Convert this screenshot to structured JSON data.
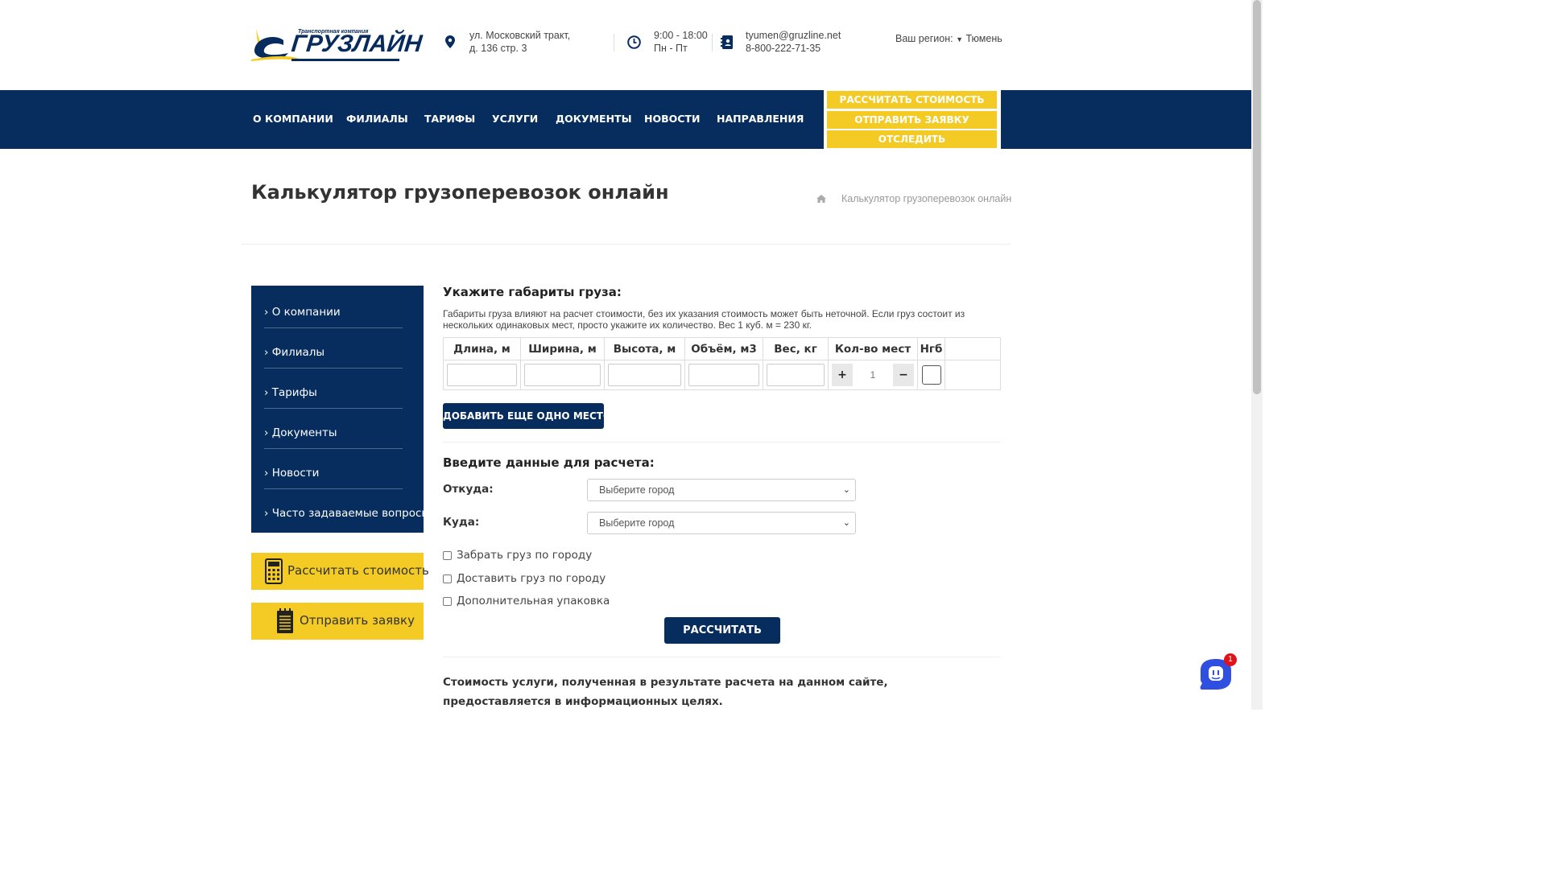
{
  "header": {
    "logo_text": "ГРУЗЛАЙН",
    "logo_subtext": "Транспортная компания",
    "address_line1": "ул. Московский тракт,",
    "address_line2": "д. 136 стр. 3",
    "hours_line1": "9:00 - 18:00",
    "hours_line2": "Пн - Пт",
    "email": "tyumen@gruzline.net",
    "phone": "8-800-222-71-35",
    "region_label": "Ваш регион:",
    "region_value": "Тюмень"
  },
  "nav": {
    "items": [
      "О КОМПАНИИ",
      "ФИЛИАЛЫ",
      "ТАРИФЫ",
      "УСЛУГИ",
      "ДОКУМЕНТЫ",
      "НОВОСТИ",
      "НАПРАВЛЕНИЯ"
    ],
    "btn_calc": "РАССЧИТАТЬ СТОИМОСТЬ",
    "btn_request": "ОТПРАВИТЬ ЗАЯВКУ",
    "btn_track": "ОТСЛЕДИТЬ"
  },
  "page": {
    "title": "Калькулятор грузоперевозок онлайн",
    "breadcrumb_current": "Калькулятор грузоперевозок онлайн"
  },
  "sidebar": {
    "items": [
      "О компании",
      "Филиалы",
      "Тарифы",
      "Документы",
      "Новости",
      "Часто задаваемые вопросы"
    ],
    "btn_calc": "Рассчитать стоимость",
    "btn_request": "Отправить заявку"
  },
  "dimensions": {
    "heading": "Укажите габариты груза:",
    "note": "Габариты груза влияют на расчет стоимости, без их указания стоимость может быть неточной. Если груз состоит из нескольких одинаковых мест, просто укажите их количество. Вес 1 куб. м = 230 кг.",
    "columns": [
      "Длина, м",
      "Ширина, м",
      "Высота, м",
      "Объём, м3",
      "Вес, кг",
      "Кол-во мест",
      "Нгб"
    ],
    "quantity": "1",
    "add_button": "ДОБАВИТЬ ЕЩЕ ОДНО МЕСТО"
  },
  "route": {
    "heading": "Введите данные для расчета:",
    "from_label": "Откуда:",
    "to_label": "Куда:",
    "from_value": "Выберите город",
    "to_value": "Выберите город"
  },
  "options": {
    "pickup": "Забрать груз по городу",
    "delivery": "Доставить груз по городу",
    "packing": "Дополнительная упаковка"
  },
  "calc_button": "РАССЧИТАТЬ",
  "disclaimer": "Стоимость услуги, полученная в результате расчета на данном сайте, предоставляется в информационных целях.",
  "chat": {
    "badge": "1"
  },
  "colors": {
    "navy": "#062d5e",
    "yellow": "#f4cb24"
  }
}
